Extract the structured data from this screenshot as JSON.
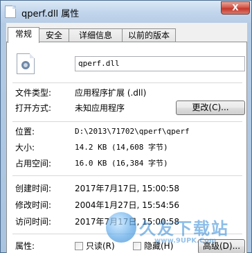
{
  "window": {
    "title": "qperf.dll 属性",
    "close_glyph": "X"
  },
  "tabs": [
    {
      "label": "常规",
      "active": true
    },
    {
      "label": "安全",
      "active": false
    },
    {
      "label": "详细信息",
      "active": false
    },
    {
      "label": "以前的版本",
      "active": false
    }
  ],
  "general": {
    "file_name": "qperf.dll",
    "file_icon": "dll-file-icon",
    "file_type_label": "文件类型:",
    "file_type_value": "应用程序扩展 (.dll)",
    "open_with_label": "打开方式:",
    "open_with_value": "未知应用程序",
    "change_button": "更改(C)...",
    "location_label": "位置:",
    "location_value": "D:\\2013\\71702\\qperf\\qperf",
    "size_label": "大小:",
    "size_value": "14.2 KB (14,608 字节)",
    "size_on_disk_label": "占用空间:",
    "size_on_disk_value": "16.0 KB (16,384 字节)",
    "created_label": "创建时间:",
    "created_value": "2017年7月17日, 15:00:58",
    "modified_label": "修改时间:",
    "modified_value": "2004年1月27日, 15:54:56",
    "accessed_label": "访问时间:",
    "accessed_value": "2017年7月17日, 15:00:58",
    "attributes_label": "属性:",
    "readonly_label": "只读(R)",
    "readonly_checked": false,
    "hidden_label": "隐藏(H)",
    "hidden_checked": false,
    "advanced_button": "高级(D)..."
  },
  "watermark": {
    "brand": "久友下载站",
    "url": "www.9UPK.Com"
  },
  "colors": {
    "frame": "#a9c3df",
    "close_button": "#c4382b"
  }
}
